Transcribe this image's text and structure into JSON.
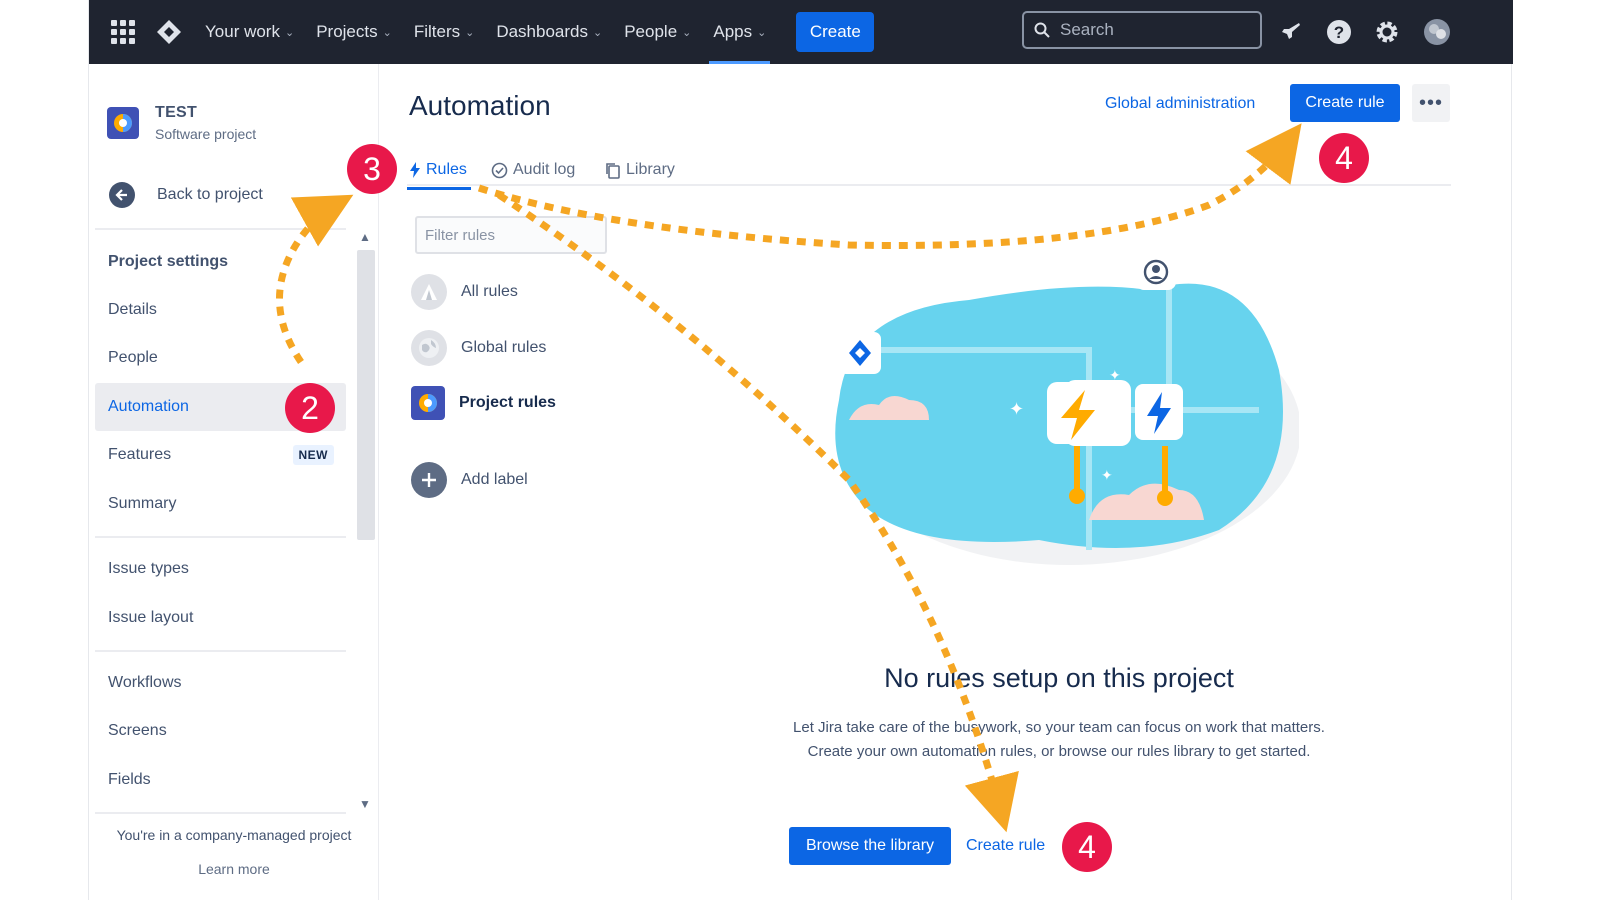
{
  "nav": {
    "items": [
      {
        "label": "Your work"
      },
      {
        "label": "Projects"
      },
      {
        "label": "Filters"
      },
      {
        "label": "Dashboards"
      },
      {
        "label": "People"
      },
      {
        "label": "Apps"
      }
    ],
    "create_label": "Create",
    "search_placeholder": "Search",
    "active_item": "Apps"
  },
  "sidebar": {
    "project_name": "TEST",
    "project_type": "Software project",
    "back_label": "Back to project",
    "heading": "Project settings",
    "items": [
      {
        "label": "Details"
      },
      {
        "label": "People"
      },
      {
        "label": "Automation"
      },
      {
        "label": "Features",
        "badge": "NEW"
      },
      {
        "label": "Summary"
      },
      {
        "label": "Issue types"
      },
      {
        "label": "Issue layout"
      },
      {
        "label": "Workflows"
      },
      {
        "label": "Screens"
      },
      {
        "label": "Fields"
      }
    ],
    "selected_item": "Automation",
    "footnote": "You're in a company-managed project",
    "learn_more": "Learn more"
  },
  "main": {
    "title": "Automation",
    "global_admin": "Global administration",
    "create_rule_label": "Create rule",
    "more_label": "•••",
    "tabs": [
      {
        "label": "Rules"
      },
      {
        "label": "Audit log"
      },
      {
        "label": "Library"
      }
    ],
    "active_tab": "Rules",
    "filter_placeholder": "Filter rules",
    "rule_groups": [
      {
        "label": "All rules"
      },
      {
        "label": "Global rules"
      },
      {
        "label": "Project rules"
      },
      {
        "label": "Add label"
      }
    ],
    "empty_title": "No rules setup on this project",
    "empty_desc": "Let Jira take care of the busywork, so your team can focus on work that matters. Create your own automation rules, or browse our rules library to get started.",
    "browse_label": "Browse the library",
    "create_link_label": "Create rule"
  },
  "annotations": {
    "step2": "2",
    "step3": "3",
    "step4_top": "4",
    "step4_bottom": "4"
  },
  "colors": {
    "nav_bg": "#1f2430",
    "primary": "#0c66e4",
    "marker": "#e8184a",
    "arrow": "#f5a623"
  }
}
